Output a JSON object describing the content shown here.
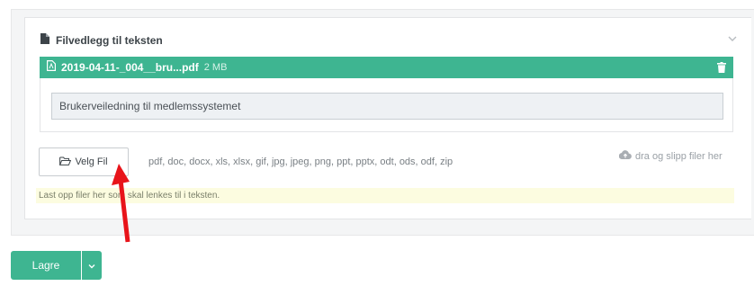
{
  "attachments": {
    "title": "Filvedlegg til teksten",
    "file": {
      "name": "2019-04-11-_004__bru...pdf",
      "size": "2 MB",
      "description_value": "Brukerveiledning til medlemssystemet"
    },
    "choose_file_label": "Velg Fil",
    "allowed_types": "pdf, doc, docx, xls, xlsx, gif, jpg, jpeg, png, ppt, pptx, odt, ods, odf, zip",
    "drop_hint": "dra og slipp filer her",
    "help_text": "Last opp filer her som skal lenkes til i teksten."
  },
  "footer": {
    "save_label": "Lagre"
  },
  "colors": {
    "accent": "#3eb591",
    "annotation_arrow": "#e8141a",
    "hint_background": "#fcfce0"
  },
  "icons": {
    "section": "document-icon",
    "file": "pdf-file-icon",
    "delete": "trash-icon",
    "choose": "folder-open-icon",
    "drop": "cloud-upload-icon",
    "collapse": "chevron-down-icon",
    "menu": "caret-down-icon"
  }
}
